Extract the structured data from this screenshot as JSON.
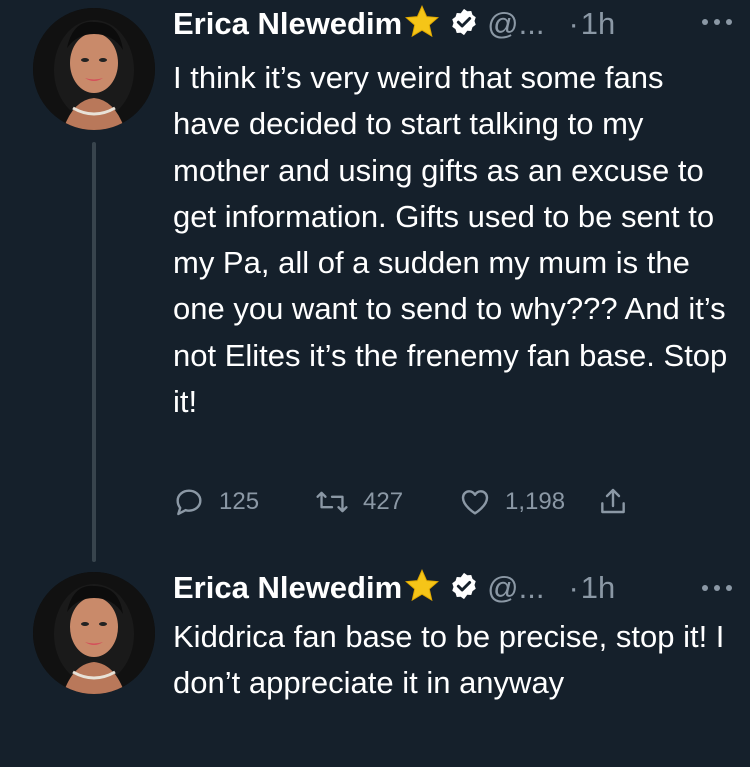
{
  "tweets": [
    {
      "name": "Erica Nlewedim",
      "handle": "@...",
      "dot": "·",
      "time": "1h",
      "text": "I think it’s very weird that some fans have decided to start talking to my mother and using gifts as an excuse to get information. Gifts used to be sent to my Pa, all of a sudden my mum is the one you want to send to why??? And it’s not Elites it’s the frenemy fan base. Stop it!",
      "replies": "125",
      "retweets": "427",
      "likes": "1,198"
    },
    {
      "name": "Erica Nlewedim",
      "handle": "@...",
      "dot": "·",
      "time": "1h",
      "text": "Kiddrica fan base to be precise, stop it! I don’t appreciate it in anyway"
    }
  ],
  "icons": {
    "star": "star-icon",
    "verified": "verified-badge-icon",
    "more": "more-dots-icon",
    "reply": "reply-icon",
    "retweet": "retweet-icon",
    "like": "heart-icon",
    "share": "share-icon"
  },
  "colors": {
    "background": "#15202b",
    "text": "#ffffff",
    "secondary": "#8b98a5",
    "thread_line": "#38444d",
    "star": "#f5c518"
  }
}
